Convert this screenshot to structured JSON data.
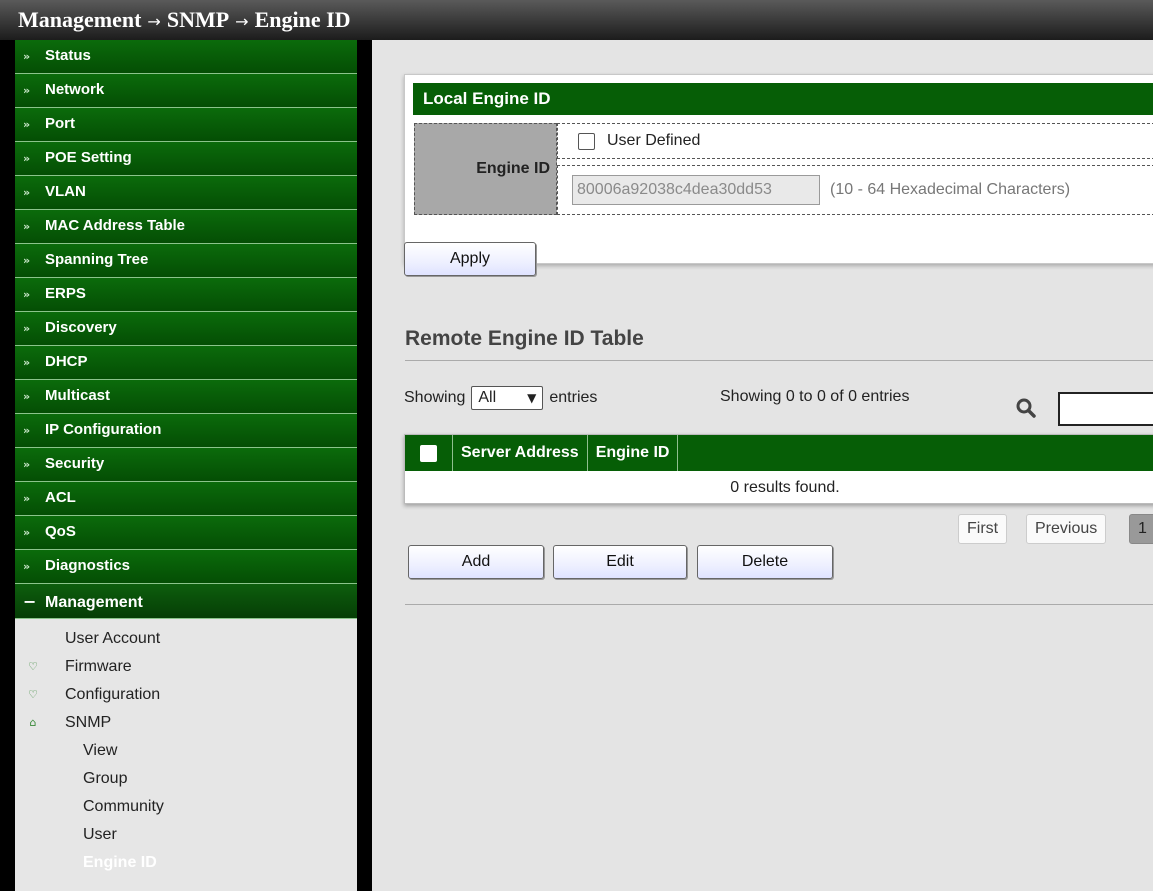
{
  "breadcrumb": {
    "root": "Management",
    "middle": "SNMP",
    "current": "Engine ID",
    "separator": "→"
  },
  "sidebar": {
    "items": [
      {
        "label": "Status"
      },
      {
        "label": "Network"
      },
      {
        "label": "Port"
      },
      {
        "label": "POE Setting"
      },
      {
        "label": "VLAN"
      },
      {
        "label": "MAC Address Table"
      },
      {
        "label": "Spanning Tree"
      },
      {
        "label": "ERPS"
      },
      {
        "label": "Discovery"
      },
      {
        "label": "DHCP"
      },
      {
        "label": "Multicast"
      },
      {
        "label": "IP Configuration"
      },
      {
        "label": "Security"
      },
      {
        "label": "ACL"
      },
      {
        "label": "QoS"
      },
      {
        "label": "Diagnostics"
      }
    ],
    "open_item": {
      "label": "Management",
      "marker": "−"
    },
    "collapsed_marker": "»",
    "sub_items": [
      {
        "label": "User Account"
      },
      {
        "label": "Firmware"
      },
      {
        "label": "Configuration"
      },
      {
        "label": "SNMP"
      }
    ],
    "snmp_items": [
      {
        "label": "View"
      },
      {
        "label": "Group"
      },
      {
        "label": "Community"
      },
      {
        "label": "User"
      },
      {
        "label": "Engine ID"
      }
    ]
  },
  "local_engine": {
    "header": "Local Engine ID",
    "field_label": "Engine ID",
    "user_defined_label": "User Defined",
    "user_defined_checked": false,
    "engine_id_value": "80006a92038c4dea30dd53",
    "hint": "(10 - 64 Hexadecimal Characters)"
  },
  "apply_label": "Apply",
  "remote_table": {
    "title": "Remote Engine ID Table",
    "showing_prefix": "Showing",
    "page_size_selected": "All",
    "showing_suffix": "entries",
    "info": "Showing 0 to 0 of 0 entries",
    "search_value": "",
    "columns": [
      "Server Address",
      "Engine ID"
    ],
    "empty_text": "0 results found.",
    "pager": {
      "first": "First",
      "previous": "Previous",
      "current": "1"
    }
  },
  "actions": {
    "add": "Add",
    "edit": "Edit",
    "delete": "Delete"
  },
  "colors": {
    "accent_green": "#065e06",
    "sidebar_green": "#0b6b0b",
    "panel_label_gray": "#a8a8a8"
  },
  "icons": {
    "search": "search-icon",
    "collapsed": "chevron-double-down-icon",
    "expanded": "minus-icon"
  }
}
